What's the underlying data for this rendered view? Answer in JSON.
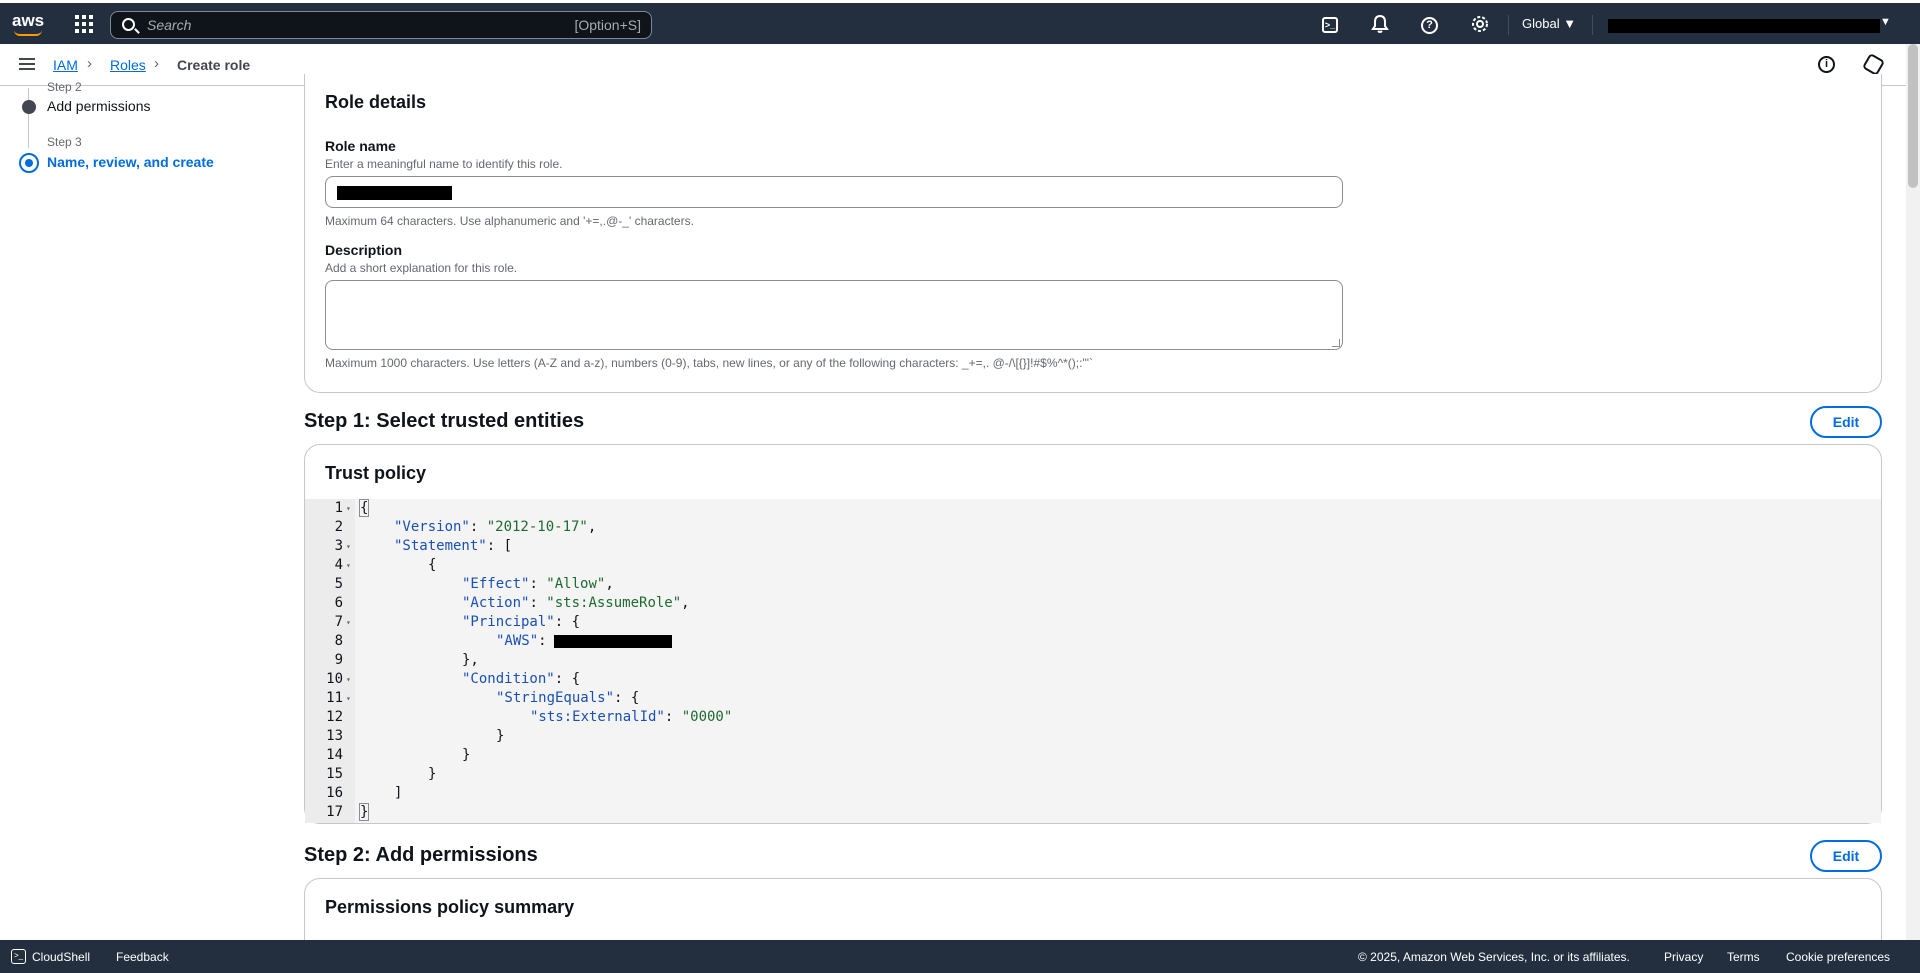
{
  "topbar": {
    "logo_text": "aws",
    "search_placeholder": "Search",
    "search_shortcut": "[Option+S]",
    "region": "Global"
  },
  "breadcrumb": {
    "items": [
      "IAM",
      "Roles",
      "Create role"
    ]
  },
  "steps": {
    "cut_label": "Step 2",
    "step2_title": "Add permissions",
    "step3_num": "Step 3",
    "step3_title": "Name, review, and create"
  },
  "role_details": {
    "title": "Role details",
    "name_label": "Role name",
    "name_desc": "Enter a meaningful name to identify this role.",
    "name_hint": "Maximum 64 characters. Use alphanumeric and '+=,.@-_' characters.",
    "desc_label": "Description",
    "desc_desc": "Add a short explanation for this role.",
    "desc_hint": "Maximum 1000 characters. Use letters (A-Z and a-z), numbers (0-9), tabs, new lines, or any of the following characters: _+=,. @-/\\[{}]!#$%^*();:\"'`"
  },
  "step1": {
    "heading": "Step 1: Select trusted entities",
    "edit": "Edit",
    "card_title": "Trust policy",
    "code_lines": [
      {
        "n": "1",
        "fold": true
      },
      {
        "n": "2",
        "fold": false
      },
      {
        "n": "3",
        "fold": true
      },
      {
        "n": "4",
        "fold": true
      },
      {
        "n": "5",
        "fold": false
      },
      {
        "n": "6",
        "fold": false
      },
      {
        "n": "7",
        "fold": true
      },
      {
        "n": "8",
        "fold": false
      },
      {
        "n": "9",
        "fold": false
      },
      {
        "n": "10",
        "fold": true
      },
      {
        "n": "11",
        "fold": true
      },
      {
        "n": "12",
        "fold": false
      },
      {
        "n": "13",
        "fold": false
      },
      {
        "n": "14",
        "fold": false
      },
      {
        "n": "15",
        "fold": false
      },
      {
        "n": "16",
        "fold": false
      },
      {
        "n": "17",
        "fold": false
      }
    ],
    "code": {
      "open": "{",
      "version_key": "\"Version\"",
      "version_val": "\"2012-10-17\"",
      "statement_key": "\"Statement\"",
      "effect_key": "\"Effect\"",
      "effect_val": "\"Allow\"",
      "action_key": "\"Action\"",
      "action_val": "\"sts:AssumeRole\"",
      "principal_key": "\"Principal\"",
      "aws_key": "\"AWS\"",
      "condition_key": "\"Condition\"",
      "stringequals_key": "\"StringEquals\"",
      "externalid_key": "\"sts:ExternalId\"",
      "externalid_val": "\"0000\"",
      "close": "}"
    }
  },
  "step2": {
    "heading": "Step 2: Add permissions",
    "edit": "Edit",
    "card_title": "Permissions policy summary"
  },
  "footer": {
    "cloudshell": "CloudShell",
    "feedback": "Feedback",
    "copyright": "© 2025, Amazon Web Services, Inc. or its affiliates.",
    "privacy": "Privacy",
    "terms": "Terms",
    "cookies": "Cookie preferences"
  },
  "icons": {
    "help": "?",
    "info": "i",
    "term": ">_",
    "cs": ">_"
  }
}
